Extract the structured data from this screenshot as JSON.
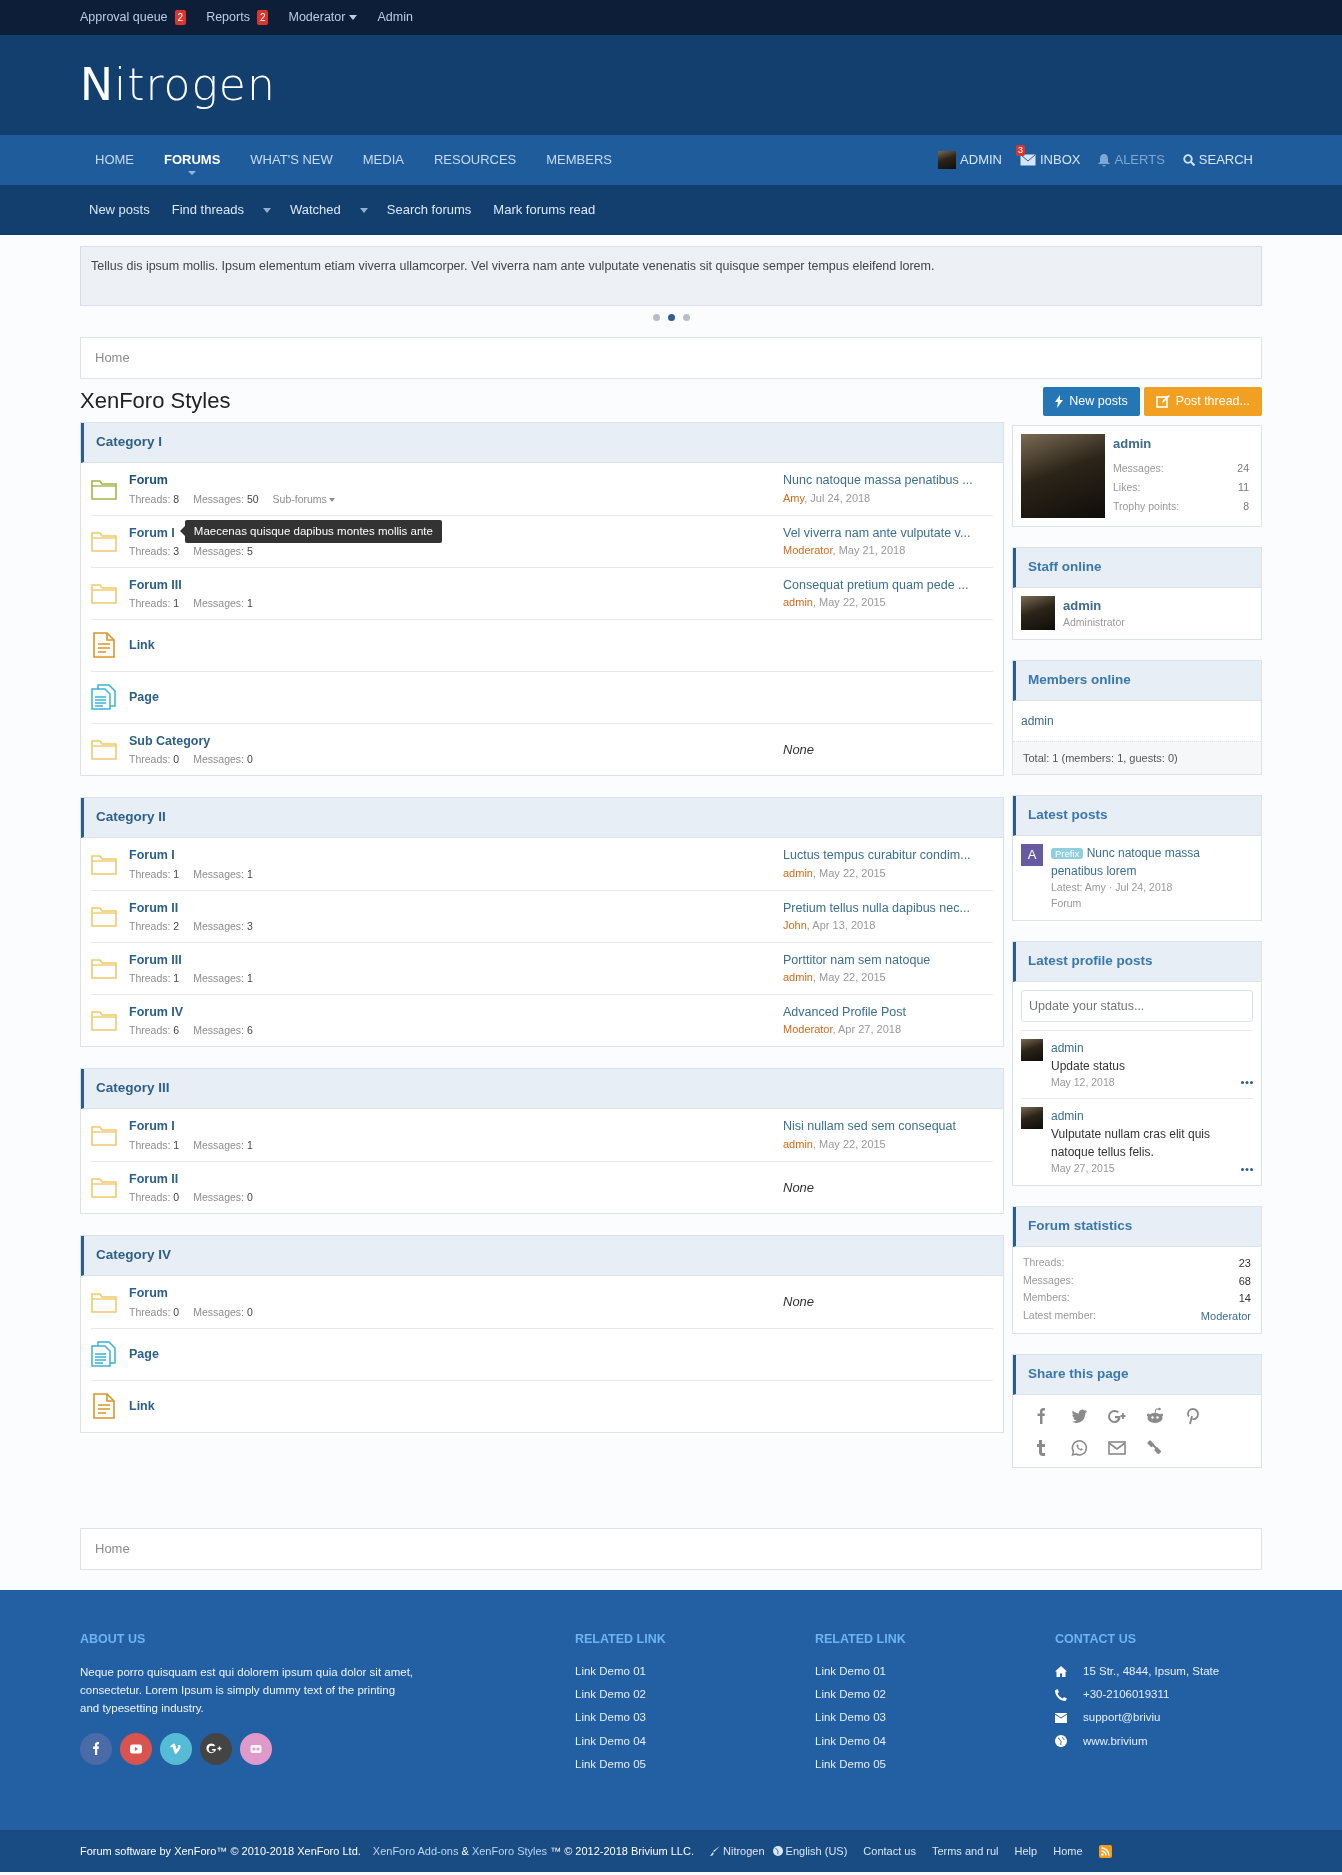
{
  "top_bar": [
    {
      "label": "Approval queue",
      "badge": "2"
    },
    {
      "label": "Reports",
      "badge": "2"
    },
    {
      "label": "Moderator",
      "dropdown": true
    },
    {
      "label": "Admin"
    }
  ],
  "logo": {
    "initial": "N",
    "rest": "itrogen"
  },
  "nav_tabs": [
    {
      "label": "HOME",
      "selected": false
    },
    {
      "label": "FORUMS",
      "selected": true
    },
    {
      "label": "WHAT'S NEW",
      "selected": false
    },
    {
      "label": "MEDIA",
      "selected": false
    },
    {
      "label": "RESOURCES",
      "selected": false
    },
    {
      "label": "MEMBERS",
      "selected": false
    }
  ],
  "user_nav": [
    {
      "kind": "account",
      "label": "ADMIN"
    },
    {
      "kind": "inbox",
      "label": "INBOX",
      "badge": "3"
    },
    {
      "kind": "alerts",
      "label": "ALERTS"
    },
    {
      "kind": "search",
      "label": "SEARCH"
    }
  ],
  "sub_nav": [
    {
      "label": "New posts",
      "dropdown": false
    },
    {
      "label": "Find threads",
      "dropdown": true
    },
    {
      "label": "Watched",
      "dropdown": true
    },
    {
      "label": "Search forums",
      "dropdown": false
    },
    {
      "label": "Mark forums read",
      "dropdown": false
    }
  ],
  "notice": {
    "text": "Tellus dis ipsum mollis. Ipsum elementum etiam viverra ullamcorper. Vel viverra nam ante vulputate venenatis sit quisque semper tempus eleifend lorem.",
    "slides": [
      {
        "selected": false
      },
      {
        "selected": true
      },
      {
        "selected": false
      }
    ]
  },
  "breadcrumb_top": "Home",
  "page_title": "XenForo Styles",
  "buttons": [
    {
      "kind": "new_posts",
      "label": "New posts"
    },
    {
      "kind": "post_thread",
      "label": "Post thread..."
    }
  ],
  "categories": [
    {
      "title": "Category I",
      "nodes": [
        {
          "kind": "forum",
          "title": "Forum",
          "unread": true,
          "stats": [
            {
              "label": "Threads:",
              "value": "8"
            },
            {
              "label": "Messages:",
              "value": "50"
            }
          ],
          "subforums": "Sub-forums",
          "last_post": {
            "title": "Nunc natoque massa penatibus ...",
            "user": "Amy",
            "date_text": ", Jul 24, 2018"
          }
        },
        {
          "kind": "forum",
          "title": "Forum I",
          "unread": false,
          "tooltip": "Maecenas quisque dapibus montes mollis ante",
          "stats": [
            {
              "label": "Threads:",
              "value": "3"
            },
            {
              "label": "Messages:",
              "value": "5"
            }
          ],
          "last_post": {
            "title": "Vel viverra nam ante vulputate v...",
            "user": "Moderator",
            "date_text": ", May 21, 2018"
          }
        },
        {
          "kind": "forum",
          "title": "Forum III",
          "unread": false,
          "stats": [
            {
              "label": "Threads:",
              "value": "1"
            },
            {
              "label": "Messages:",
              "value": "1"
            }
          ],
          "last_post": {
            "title": "Consequat pretium quam pede ...",
            "user": "admin",
            "date_text": ", May 22, 2015"
          }
        },
        {
          "kind": "link",
          "title": "Link"
        },
        {
          "kind": "page",
          "title": "Page"
        },
        {
          "kind": "forum",
          "title": "Sub Category",
          "unread": false,
          "stats": [
            {
              "label": "Threads:",
              "value": "0"
            },
            {
              "label": "Messages:",
              "value": "0"
            }
          ],
          "last_post": {
            "empty": "None"
          }
        }
      ]
    },
    {
      "title": "Category II",
      "nodes": [
        {
          "kind": "forum",
          "title": "Forum I",
          "unread": false,
          "stats": [
            {
              "label": "Threads:",
              "value": "1"
            },
            {
              "label": "Messages:",
              "value": "1"
            }
          ],
          "last_post": {
            "title": "Luctus tempus curabitur condim...",
            "user": "admin",
            "date_text": ", May 22, 2015"
          }
        },
        {
          "kind": "forum",
          "title": "Forum II",
          "unread": false,
          "stats": [
            {
              "label": "Threads:",
              "value": "2"
            },
            {
              "label": "Messages:",
              "value": "3"
            }
          ],
          "last_post": {
            "title": "Pretium tellus nulla dapibus nec...",
            "user": "John",
            "date_text": ", Apr 13, 2018"
          }
        },
        {
          "kind": "forum",
          "title": "Forum III",
          "unread": false,
          "stats": [
            {
              "label": "Threads:",
              "value": "1"
            },
            {
              "label": "Messages:",
              "value": "1"
            }
          ],
          "last_post": {
            "title": "Porttitor nam sem natoque",
            "user": "admin",
            "date_text": ", May 22, 2015"
          }
        },
        {
          "kind": "forum",
          "title": "Forum IV",
          "unread": false,
          "stats": [
            {
              "label": "Threads:",
              "value": "6"
            },
            {
              "label": "Messages:",
              "value": "6"
            }
          ],
          "last_post": {
            "title": "Advanced Profile Post",
            "user": "Moderator",
            "date_text": ", Apr 27, 2018"
          }
        }
      ]
    },
    {
      "title": "Category III",
      "nodes": [
        {
          "kind": "forum",
          "title": "Forum I",
          "unread": false,
          "stats": [
            {
              "label": "Threads:",
              "value": "1"
            },
            {
              "label": "Messages:",
              "value": "1"
            }
          ],
          "last_post": {
            "title": "Nisi nullam sed sem consequat",
            "user": "admin",
            "date_text": ", May 22, 2015"
          }
        },
        {
          "kind": "forum",
          "title": "Forum II",
          "unread": false,
          "stats": [
            {
              "label": "Threads:",
              "value": "0"
            },
            {
              "label": "Messages:",
              "value": "0"
            }
          ],
          "last_post": {
            "empty": "None"
          }
        }
      ]
    },
    {
      "title": "Category IV",
      "nodes": [
        {
          "kind": "forum",
          "title": "Forum",
          "unread": false,
          "stats": [
            {
              "label": "Threads:",
              "value": "0"
            },
            {
              "label": "Messages:",
              "value": "0"
            }
          ],
          "last_post": {
            "empty": "None"
          }
        },
        {
          "kind": "page",
          "title": "Page"
        },
        {
          "kind": "link",
          "title": "Link"
        }
      ]
    }
  ],
  "breadcrumb_bottom": "Home",
  "profile": {
    "name": "admin",
    "stats": [
      {
        "label": "Messages:",
        "value": "24"
      },
      {
        "label": "Likes:",
        "value": "11"
      },
      {
        "label": "Trophy points:",
        "value": "8"
      }
    ]
  },
  "staff_online": {
    "title": "Staff online",
    "members": [
      {
        "name": "admin",
        "role": "Administrator"
      }
    ]
  },
  "members_online": {
    "title": "Members online",
    "members": [
      "admin"
    ],
    "total": "Total: 1 (members: 1, guests: 0)"
  },
  "latest_posts": {
    "title": "Latest posts",
    "posts": [
      {
        "avatar_letter": "A",
        "prefix": "Prefix",
        "title": "Nunc natoque massa penatibus lorem",
        "meta": "Latest: Amy · Jul 24, 2018",
        "forum": "Forum"
      }
    ]
  },
  "latest_profile_posts": {
    "title": "Latest profile posts",
    "placeholder": "Update your status...",
    "posts": [
      {
        "user": "admin",
        "text": "Update status",
        "date": "May 12, 2018"
      },
      {
        "user": "admin",
        "text": "Vulputate nullam cras elit quis natoque tellus felis.",
        "date": "May 27, 2015"
      }
    ]
  },
  "forum_statistics": {
    "title": "Forum statistics",
    "rows": [
      {
        "label": "Threads:",
        "value": "23"
      },
      {
        "label": "Messages:",
        "value": "68"
      },
      {
        "label": "Members:",
        "value": "14"
      },
      {
        "label": "Latest member:",
        "value": "Moderator",
        "kind": "user"
      }
    ]
  },
  "share": {
    "title": "Share this page"
  },
  "footer": {
    "about": {
      "title": "ABOUT US",
      "text": "Neque porro quisquam est qui dolorem ipsum quia dolor sit amet, consectetur. Lorem Ipsum is simply dummy text of the printing and typesetting industry."
    },
    "related": [
      {
        "title": "RELATED LINK",
        "links": [
          "Link Demo 01",
          "Link Demo 02",
          "Link Demo 03",
          "Link Demo 04",
          "Link Demo 05"
        ]
      },
      {
        "title": "RELATED LINK",
        "links": [
          "Link Demo 01",
          "Link Demo 02",
          "Link Demo 03",
          "Link Demo 04",
          "Link Demo 05"
        ]
      }
    ],
    "contact": {
      "title": "CONTACT US",
      "items": [
        {
          "kind": "address",
          "text": "15 Str., 4844, Ipsum, State"
        },
        {
          "kind": "phone",
          "text": "+30-2106019311"
        },
        {
          "kind": "email",
          "text": "support@briviu"
        },
        {
          "kind": "web",
          "text": "www.brivium"
        }
      ]
    }
  },
  "bottom_bar": {
    "copyright": "Forum software by XenForo™ © 2010-2018 XenForo Ltd.",
    "credits": [
      {
        "text": "XenForo Add-ons",
        "link": true
      },
      {
        "text": " & ",
        "link": false
      },
      {
        "text": "XenForo Styles",
        "link": true
      },
      {
        "text": " ™ © 2012-2018 Brivium LLC.",
        "link": false
      }
    ],
    "links": [
      {
        "kind": "style",
        "label": "Nitrogen"
      },
      {
        "kind": "language",
        "label": "English (US)"
      },
      {
        "kind": "plain",
        "label": "Contact us"
      },
      {
        "kind": "plain",
        "label": "Terms and rul"
      },
      {
        "kind": "plain",
        "label": "Help"
      },
      {
        "kind": "plain",
        "label": "Home"
      },
      {
        "kind": "rss"
      }
    ]
  }
}
